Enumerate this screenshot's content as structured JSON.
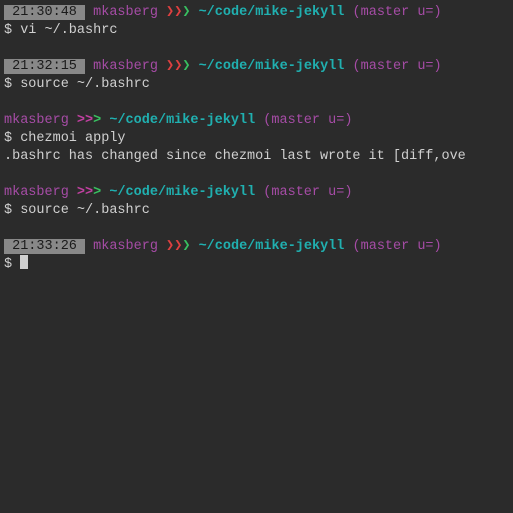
{
  "blocks": [
    {
      "prompt": {
        "time": "21:30:48",
        "user": "mkasberg",
        "sep_style": "red",
        "path": "~/code/mike-jekyll",
        "branch": "master u="
      },
      "command": "vi ~/.bashrc",
      "output": null
    },
    {
      "prompt": {
        "time": "21:32:15",
        "user": "mkasberg",
        "sep_style": "red",
        "path": "~/code/mike-jekyll",
        "branch": "master u="
      },
      "command": "source ~/.bashrc",
      "output": null
    },
    {
      "prompt": {
        "time": null,
        "user": "mkasberg",
        "sep_style": "magenta",
        "path": "~/code/mike-jekyll",
        "branch": "master u="
      },
      "command": "chezmoi apply",
      "output": ".bashrc has changed since chezmoi last wrote it [diff,ove"
    },
    {
      "prompt": {
        "time": null,
        "user": "mkasberg",
        "sep_style": "magenta",
        "path": "~/code/mike-jekyll",
        "branch": "master u="
      },
      "command": "source ~/.bashrc",
      "output": null
    },
    {
      "prompt": {
        "time": "21:33:26",
        "user": "mkasberg",
        "sep_style": "red",
        "path": "~/code/mike-jekyll",
        "branch": "master u="
      },
      "command": "",
      "output": null,
      "cursor": true
    }
  ],
  "glyphs": {
    "sep_fancy": "❯❯❯",
    "sep_plain": ">>>",
    "dollar": "$"
  }
}
